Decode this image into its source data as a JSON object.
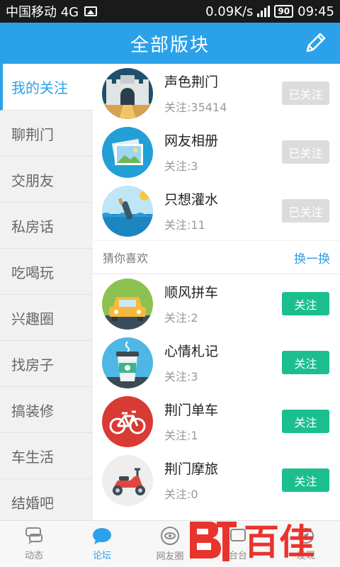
{
  "statusbar": {
    "carrier": "中国移动 4G",
    "speed": "0.09K/s",
    "network": "4G",
    "battery": "90",
    "time": "09:45"
  },
  "header": {
    "title": "全部版块"
  },
  "sidebar": {
    "items": [
      {
        "label": "我的关注",
        "active": true
      },
      {
        "label": "聊荆门"
      },
      {
        "label": "交朋友"
      },
      {
        "label": "私房话"
      },
      {
        "label": "吃喝玩"
      },
      {
        "label": "兴趣圈"
      },
      {
        "label": "找房子"
      },
      {
        "label": "搞装修"
      },
      {
        "label": "车生活"
      },
      {
        "label": "结婚吧"
      }
    ]
  },
  "followed": [
    {
      "name": "声色荆门",
      "count": "关注:35414",
      "button": "已关注",
      "icon": "city-gate-icon"
    },
    {
      "name": "网友相册",
      "count": "关注:3",
      "button": "已关注",
      "icon": "photo-album-icon"
    },
    {
      "name": "只想灌水",
      "count": "关注:11",
      "button": "已关注",
      "icon": "bottle-sea-icon"
    }
  ],
  "suggest": {
    "label": "猜你喜欢",
    "refresh": "换一换"
  },
  "recommended": [
    {
      "name": "顺风拼车",
      "count": "关注:2",
      "button": "关注",
      "icon": "car-icon"
    },
    {
      "name": "心情札记",
      "count": "关注:3",
      "button": "关注",
      "icon": "coffee-cup-icon"
    },
    {
      "name": "荆门单车",
      "count": "关注:1",
      "button": "关注",
      "icon": "bicycle-icon"
    },
    {
      "name": "荆门摩旅",
      "count": "关注:0",
      "button": "关注",
      "icon": "scooter-icon"
    }
  ],
  "bottomnav": [
    {
      "label": "动态",
      "icon": "dynamic-icon"
    },
    {
      "label": "论坛",
      "icon": "forum-icon",
      "active": true
    },
    {
      "label": "网友圈",
      "icon": "friends-circle-icon"
    },
    {
      "label": "台台",
      "icon": "platform-icon"
    },
    {
      "label": "发现",
      "icon": "discover-icon"
    }
  ],
  "watermark": {
    "text": "百佳"
  },
  "colors": {
    "accent": "#2ba1ea",
    "follow_green": "#1bbf8f",
    "followed_gray": "#dcdcdc"
  }
}
